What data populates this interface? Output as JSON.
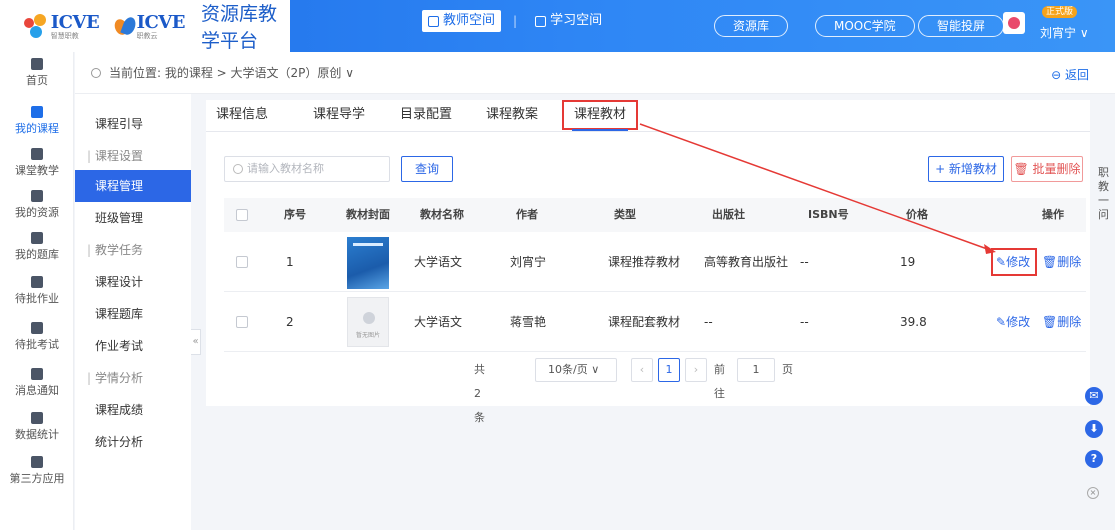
{
  "header": {
    "logo1_text": "ICVE",
    "logo1_sub": "智慧职教",
    "logo2_text": "ICVE",
    "logo2_sub": "职教云",
    "platform_name": "资源库教学平台",
    "space_tabs": [
      {
        "label": "教师空间"
      },
      {
        "label": "学习空间"
      }
    ],
    "separator": "|",
    "pills": [
      "资源库",
      "MOOC学院",
      "智能投屏"
    ],
    "badge": "正式版",
    "username": "刘宵宁 ∨"
  },
  "iconbar": [
    {
      "label": "首页"
    },
    {
      "label": "我的课程"
    },
    {
      "label": "课堂教学"
    },
    {
      "label": "我的资源"
    },
    {
      "label": "我的题库"
    },
    {
      "label": "待批作业"
    },
    {
      "label": "待批考试"
    },
    {
      "label": "消息通知"
    },
    {
      "label": "数据统计"
    },
    {
      "label": "第三方应用"
    }
  ],
  "breadcrumb": {
    "text": "当前位置: 我的课程 > 大学语文（2P）原创 ∨",
    "back": "返回"
  },
  "submenu": [
    {
      "label": "课程引导",
      "type": "item"
    },
    {
      "label": "课程设置",
      "type": "group"
    },
    {
      "label": "课程管理",
      "type": "item"
    },
    {
      "label": "班级管理",
      "type": "item"
    },
    {
      "label": "教学任务",
      "type": "group"
    },
    {
      "label": "课程设计",
      "type": "item"
    },
    {
      "label": "课程题库",
      "type": "item"
    },
    {
      "label": "作业考试",
      "type": "item"
    },
    {
      "label": "学情分析",
      "type": "group"
    },
    {
      "label": "课程成绩",
      "type": "item"
    },
    {
      "label": "统计分析",
      "type": "item"
    }
  ],
  "tabs": [
    {
      "label": "课程信息"
    },
    {
      "label": "课程导学"
    },
    {
      "label": "目录配置"
    },
    {
      "label": "课程教案"
    },
    {
      "label": "课程教材"
    }
  ],
  "toolbar": {
    "search_placeholder": "请输入教材名称",
    "query": "查询",
    "add": "+ 新增教材",
    "batch_delete": "批量删除"
  },
  "table": {
    "headers": [
      "序号",
      "教材封面",
      "教材名称",
      "作者",
      "类型",
      "出版社",
      "ISBN号",
      "价格",
      "操作"
    ],
    "rows": [
      {
        "index": "1",
        "name": "大学语文",
        "author": "刘宵宁",
        "type": "课程推荐教材",
        "publisher": "高等教育出版社",
        "isbn": "--",
        "price": "19"
      },
      {
        "index": "2",
        "name": "大学语文",
        "author": "蒋雪艳",
        "type": "课程配套教材",
        "publisher": "--",
        "isbn": "--",
        "price": "39.8",
        "cover_text": "暂无图片"
      }
    ],
    "edit": "修改",
    "delete": "删除"
  },
  "pager": {
    "total": "共 2 条",
    "page_size": "10条/页",
    "current": "1",
    "goto_prefix": "前往",
    "goto_value": "1",
    "goto_suffix": "页"
  },
  "side_edge": "职教一问",
  "colors": {
    "primary": "#2c67e6",
    "header": "#1e6ee8",
    "annotation": "#e53935"
  }
}
